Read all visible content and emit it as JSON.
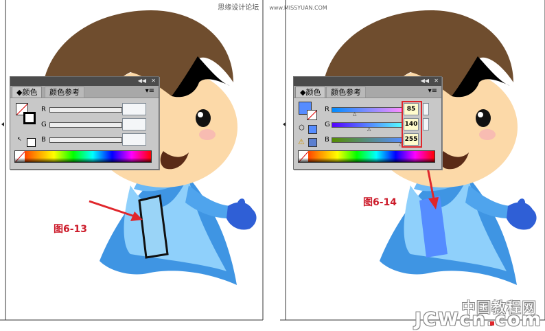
{
  "header": {
    "site_name": "思缘设计论坛",
    "site_url": "www.MISSYUAN.COM"
  },
  "panel": {
    "tab_color": "颜色",
    "tab_guide": "颜色参考",
    "channels": {
      "r": "R",
      "g": "G",
      "b": "B"
    },
    "icons": {
      "collapse": "double-chevron-icon",
      "close": "close-icon",
      "menu": "panel-menu-icon"
    }
  },
  "left": {
    "figure_label": "图6-13",
    "values": {
      "r": "",
      "g": "",
      "b": ""
    }
  },
  "right": {
    "figure_label": "图6-14",
    "values": {
      "r": "85",
      "g": "140",
      "b": "255"
    },
    "fill_color": "#558cff"
  },
  "watermark": {
    "cn": "中国教程网",
    "en": "JCWcn.com"
  },
  "colors": {
    "accent_red": "#e0262b",
    "label_red": "#cc1b2a",
    "panel_gray": "#c8c8c8"
  }
}
